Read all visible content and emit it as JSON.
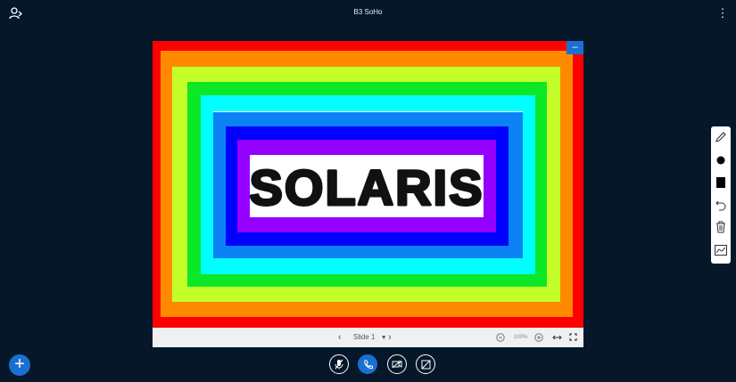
{
  "header": {
    "title": "B3 SoHo",
    "menu_icon": "kebab-menu-icon",
    "user_icon": "user-list-toggle-icon"
  },
  "presentation": {
    "slide_text": "SOLARIS",
    "band_colors": [
      "#ff0000",
      "#ff8a00",
      "#c4ff2a",
      "#0de826",
      "#00ffff",
      "#0b83f5",
      "#0000ff",
      "#9400ff",
      "#ffffff"
    ],
    "minimize_label": "–"
  },
  "slide_controls": {
    "prev_icon": "chevron-left-icon",
    "slide_label": "Slide 1",
    "next_icon": "chevron-right-icon",
    "zoom_out_icon": "zoom-out-icon",
    "zoom_level": "100%",
    "zoom_in_icon": "zoom-in-icon",
    "fit_width_icon": "fit-width-icon",
    "fullscreen_icon": "fullscreen-icon"
  },
  "whiteboard_tools": [
    "pencil-icon",
    "dot-size-icon",
    "color-square-icon",
    "undo-icon",
    "delete-icon",
    "multi-user-icon"
  ],
  "bottom_actions": {
    "plus_label": "+",
    "mic_icon": "microphone-muted-icon",
    "phone_icon": "phone-icon",
    "camera_icon": "camera-off-icon",
    "screen_share_icon": "screen-share-off-icon"
  }
}
